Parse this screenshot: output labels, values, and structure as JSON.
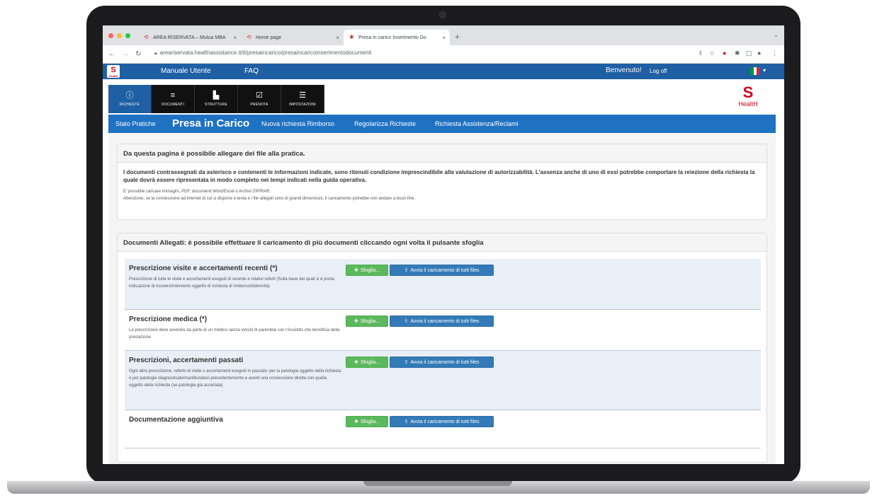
{
  "browser": {
    "tabs": [
      {
        "label": "AREA RISERVATA – Mutua MBA",
        "active": false
      },
      {
        "label": "Home page",
        "active": false
      },
      {
        "label": "Presa in carico Inserimento Do",
        "active": true
      }
    ],
    "new_tab": "+",
    "url": "areariservata.healthassistance.it/it/presaincarico/presaincaricoinserimentodocumenti"
  },
  "header": {
    "logo_small_text": "HealtH",
    "links": [
      "Manuale Utente",
      "FAQ"
    ],
    "welcome": "Benvenuto!",
    "logoff": "Log off",
    "flag_colors": [
      "#009246",
      "#ffffff",
      "#ce2b37"
    ]
  },
  "menu": {
    "items": [
      {
        "label": "RICHIESTE",
        "icon": "info-icon",
        "active": true
      },
      {
        "label": "DOCUMENTI",
        "icon": "list-icon",
        "active": false
      },
      {
        "label": "STRUTTURE",
        "icon": "building-icon",
        "active": false
      },
      {
        "label": "PRENOTA",
        "icon": "calendar-check-icon",
        "active": false
      },
      {
        "label": "IMPOSTAZIONI",
        "icon": "sliders-icon",
        "active": false
      }
    ],
    "brand": "HealtH"
  },
  "subnav": {
    "items": [
      {
        "label": "Stato Pratiche",
        "current": false
      },
      {
        "label": "Presa in Carico",
        "current": true
      },
      {
        "label": "Nuova richiesta Rimborso",
        "current": false
      },
      {
        "label": "Regolarizza Richieste",
        "current": false
      },
      {
        "label": "Richiesta Assistenza/Reclami",
        "current": false
      }
    ]
  },
  "info_panel": {
    "heading": "Da questa pagina è possibile allegare dei file alla pratica.",
    "notice": "I documenti contrassegnati da asterisco e contenenti le informazioni indicate, sono ritenuti condizione imprescindibile alla valutazione di autorizzabilità. L'assenza anche di uno di essi potrebbe comportare la reiezione della richiesta la quale dovrà essere ripresentata in modo completo nei tempi indicati nella guida operativa.",
    "formats": "E' possibile caricare immagini, PDF, documenti Word/Excel o Archivi ZIP/RAR.",
    "warning": "Attenzione, se la connessione ad internet di cui si dispone è lenta e i file allegati sono di grandi dimensioni, il caricamento potrebbe non andare a buon fine."
  },
  "docs_panel": {
    "heading": "Documenti Allegati: è possibile effettuare il caricamento di più documenti cliccando ogni volta il pulsante sfoglia",
    "browse_label": "Sfoglia...",
    "upload_label": "Avvia il caricamento di tutti files",
    "sections": [
      {
        "title": "Prescrizione visite e accertamenti recenti (*)",
        "desc": "Prescrizione di tutte le visite e accertamenti eseguiti di recente e relativi referti (Sulla base dei quali si è posta indicazione di ricovero/intervento oggetto di richiesta di rimborso/indennità)"
      },
      {
        "title": "Prescrizione medica (*)",
        "desc": "La prescrizione deve avvenire da parte di un medico senza vincoli di parentela con l'Assistito che beneficia della prestazione"
      },
      {
        "title": "Prescrizioni, accertamenti passati",
        "desc": "Ogni altra prescrizione, referto di visite o accertamenti eseguiti in passato: per la patologia oggetto della richiesta o per patologie diagnosticate/manifestatesi precedentemente e aventi una connessione diretta con quella oggetto della richiesta (se patologia già accertata)"
      },
      {
        "title": "Documentazione aggiuntiva",
        "desc": ""
      }
    ]
  }
}
